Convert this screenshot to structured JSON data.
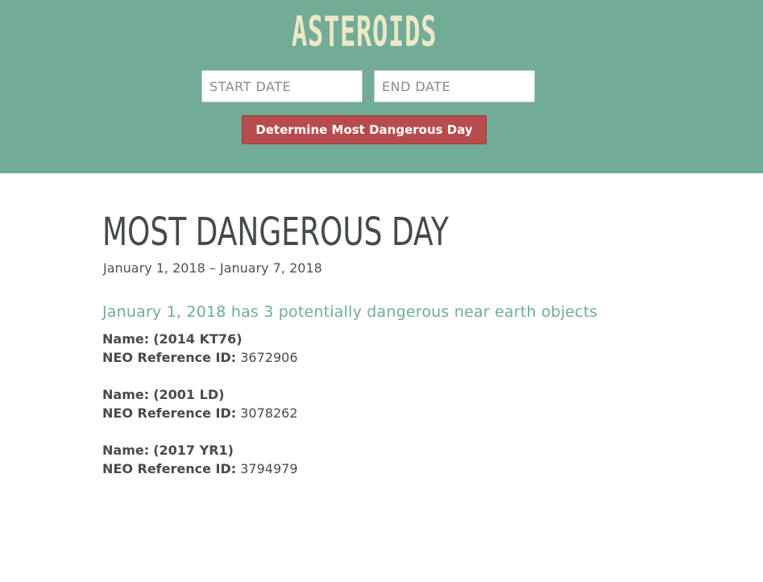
{
  "header": {
    "logo": "ASTEROIDS",
    "start_date_placeholder": "START DATE",
    "end_date_placeholder": "END DATE",
    "button_label": "Determine Most Dangerous Day"
  },
  "main": {
    "title": "MOST DANGEROUS DAY",
    "date_range": "January 1, 2018 – January 7, 2018",
    "summary": "January 1, 2018 has 3 potentially dangerous near earth objects",
    "name_label": "Name:",
    "neo_id_label": "NEO Reference ID:",
    "neos": [
      {
        "name": "(2014 KT76)",
        "ref_id": "3672906"
      },
      {
        "name": "(2001 LD)",
        "ref_id": "3078262"
      },
      {
        "name": "(2017 YR1)",
        "ref_id": "3794979"
      }
    ]
  },
  "colors": {
    "header_bg": "#72ac96",
    "logo": "#ece8c8",
    "button_bg": "#b84c4c",
    "accent_text": "#72ac96",
    "body_text": "#464b4b"
  }
}
